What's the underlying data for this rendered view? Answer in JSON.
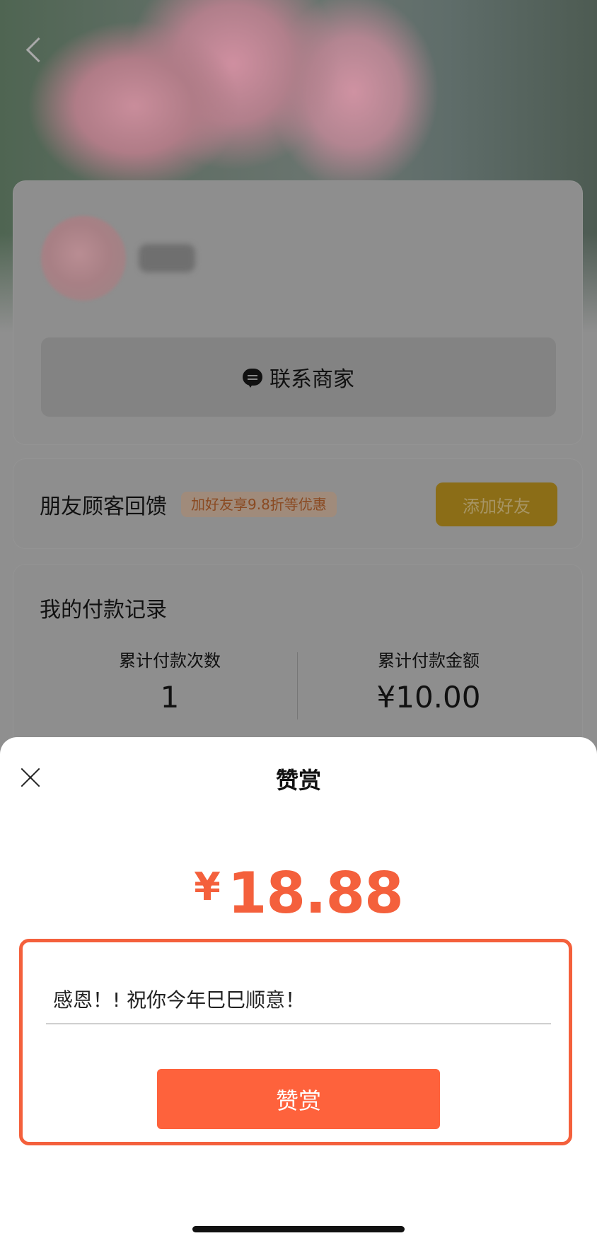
{
  "merchant": {
    "contact_label": "联系商家"
  },
  "friend": {
    "title": "朋友顾客回馈",
    "tag": "加好友享9.8折等优惠",
    "add_label": "添加好友"
  },
  "payment": {
    "title": "我的付款记录",
    "count_label": "累计付款次数",
    "count_value": "1",
    "amount_label": "累计付款金额",
    "amount_value": "¥10.00"
  },
  "sheet": {
    "title": "赞赏",
    "currency": "¥",
    "amount": "18.88",
    "message_value": "感恩！! 祝你今年巳巳顺意！",
    "reward_label": "赞赏"
  }
}
